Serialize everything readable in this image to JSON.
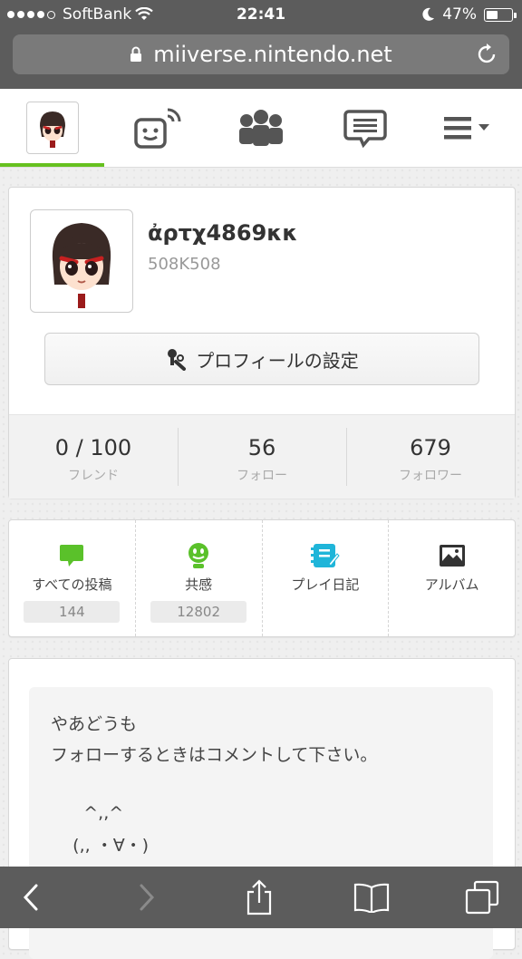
{
  "status_bar": {
    "carrier": "SoftBank",
    "time": "22:41",
    "battery": "47%"
  },
  "browser": {
    "url": "miiverse.nintendo.net"
  },
  "nav": {
    "items": [
      {
        "name": "user-page",
        "icon": "mii-avatar"
      },
      {
        "name": "activity-feed",
        "icon": "face-signal-icon"
      },
      {
        "name": "communities",
        "icon": "people-icon"
      },
      {
        "name": "messages",
        "icon": "speech-bubble-icon"
      },
      {
        "name": "menu",
        "icon": "hamburger-dropdown-icon"
      }
    ],
    "active_color": "#66c11f"
  },
  "profile": {
    "nickname": "ἀρτχ4869κκ",
    "user_id": "508K508",
    "settings_button": "プロフィールの設定",
    "stats": [
      {
        "value": "0 / 100",
        "label": "フレンド"
      },
      {
        "value": "56",
        "label": "フォロー"
      },
      {
        "value": "679",
        "label": "フォロワー"
      }
    ]
  },
  "activity_menu": [
    {
      "label": "すべての投稿",
      "count": "144",
      "icon": "post-bubble-icon",
      "color": "#5ac12a"
    },
    {
      "label": "共感",
      "count": "12802",
      "icon": "smiley-icon",
      "color": "#5ac12a"
    },
    {
      "label": "プレイ日記",
      "count": null,
      "icon": "diary-icon",
      "color": "#1fb5d9"
    },
    {
      "label": "アルバム",
      "count": null,
      "icon": "album-icon",
      "color": "#333333"
    }
  ],
  "bio": {
    "lines": [
      "やあどうも",
      "フォローするときはコメントして下さい。",
      "",
      "      ^,,^",
      "    (,, ・∀・)"
    ]
  },
  "toolbar": {
    "icons": [
      "back-icon",
      "forward-icon",
      "share-icon",
      "bookmarks-icon",
      "tabs-icon"
    ]
  }
}
